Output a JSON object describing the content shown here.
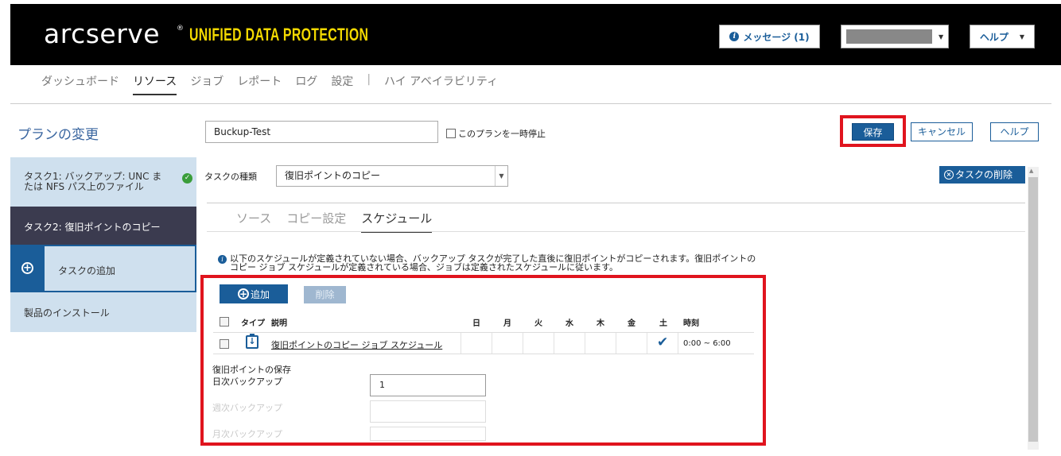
{
  "header": {
    "brand": "arcserve",
    "brand_mark": "®",
    "product": "UNIFIED DATA PROTECTION",
    "messages_label": "メッセージ (1)",
    "help_label": "ヘルプ"
  },
  "nav": {
    "items": [
      "ダッシュボード",
      "リソース",
      "ジョブ",
      "レポート",
      "ログ",
      "設定",
      "|",
      "ハイ アベイラビリティ"
    ],
    "active": "リソース"
  },
  "page": {
    "title": "プランの変更",
    "plan_name": "Buckup-Test",
    "pause_label": "このプランを一時停止",
    "save_label": "保存",
    "cancel_label": "キャンセル",
    "help_label": "ヘルプ"
  },
  "sidebar": {
    "task1": "タスク1: バックアップ: UNC または NFS パス上のファイル",
    "task2": "タスク2: 復旧ポイントのコピー",
    "add_task": "タスクの追加",
    "install": "製品のインストール"
  },
  "task": {
    "type_label": "タスクの種類",
    "type_value": "復旧ポイントのコピー",
    "delete_label": "タスクの削除"
  },
  "subtabs": {
    "source": "ソース",
    "copy_settings": "コピー設定",
    "schedule": "スケジュール",
    "active": "スケジュール"
  },
  "schedule": {
    "info": "以下のスケジュールが定義されていない場合、バックアップ タスクが完了した直後に復旧ポイントがコピーされます。復旧ポイントのコピー ジョブ スケジュールが定義されている場合、ジョブは定義されたスケジュールに従います。",
    "add_label": "追加",
    "delete_label": "削除",
    "columns": {
      "type": "タイプ",
      "desc": "説明",
      "sun": "日",
      "mon": "月",
      "tue": "火",
      "wed": "水",
      "thu": "木",
      "fri": "金",
      "sat": "土",
      "time": "時刻"
    },
    "rows": [
      {
        "desc": "復旧ポイントのコピー ジョブ スケジュール",
        "days_checked": [
          "土"
        ],
        "time": "0:00 ~ 6:00"
      }
    ]
  },
  "retention": {
    "title": "復旧ポイントの保存",
    "daily_label": "日次バックアップ",
    "daily_value": "1",
    "weekly_label": "週次バックアップ",
    "monthly_label": "月次バックアップ"
  },
  "colors": {
    "primary": "#1a5d99",
    "highlight_red": "#e0141e",
    "header_bg": "#000000",
    "brand_yellow": "#f3d900",
    "sidebar_bg": "#cfe0ee",
    "sidebar_active": "#3b3b4f"
  }
}
